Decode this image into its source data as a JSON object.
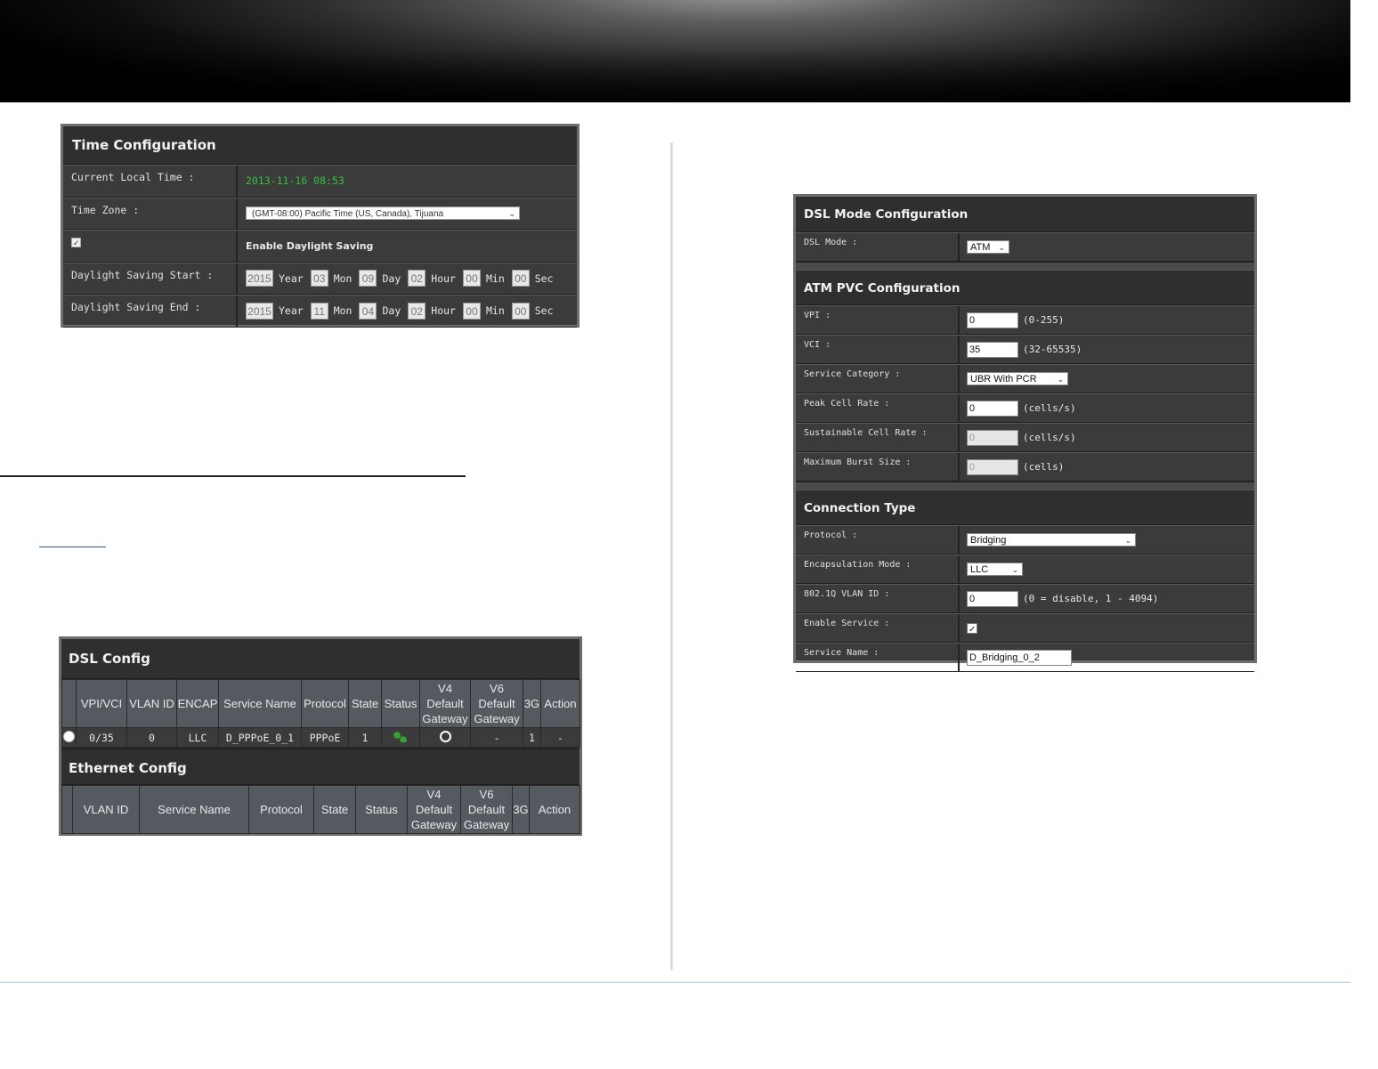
{
  "time_config": {
    "title": "Time Configuration",
    "current_local_time_label": "Current Local Time :",
    "current_local_time": "2013-11-16 08:53",
    "time_zone_label": "Time Zone :",
    "time_zone_value": "(GMT-08:00) Pacific Time (US, Canada), Tijuana",
    "daylight_saving_label": "Enable Daylight Saving",
    "daylight_saving_checked": true,
    "start_label": "Daylight Saving Start :",
    "end_label": "Daylight Saving End :",
    "units": {
      "year": "Year",
      "mon": "Mon",
      "day": "Day",
      "hour": "Hour",
      "min": "Min",
      "sec": "Sec"
    },
    "start": {
      "year": "2015",
      "mon": "03",
      "day": "09",
      "hour": "02",
      "min": "00",
      "sec": "00"
    },
    "end": {
      "year": "2015",
      "mon": "11",
      "day": "04",
      "hour": "02",
      "min": "00",
      "sec": "00"
    }
  },
  "dsl_config": {
    "title": "DSL Config",
    "columns": [
      "VPI/VCI",
      "VLAN ID",
      "ENCAP",
      "Service Name",
      "Protocol",
      "State",
      "Status",
      "V4 Default Gateway",
      "V6 Default Gateway",
      "3G",
      "Action"
    ],
    "row": {
      "vpi_vci": "0/35",
      "vlan_id": "0",
      "encap": "LLC",
      "service_name": "D_PPPoE_0_1",
      "protocol": "PPPoE",
      "state": "1",
      "v6_gateway": "-",
      "g3": "1",
      "action": "-"
    }
  },
  "ethernet_config": {
    "title": "Ethernet Config",
    "columns": [
      "VLAN ID",
      "Service Name",
      "Protocol",
      "State",
      "Status",
      "V4 Default Gateway",
      "V6 Default Gateway",
      "3G",
      "Action"
    ]
  },
  "dsl_mode": {
    "title": "DSL Mode Configuration",
    "mode_label": "DSL Mode :",
    "mode_value": "ATM"
  },
  "atm_pvc": {
    "title": "ATM PVC Configuration",
    "vpi_label": "VPI :",
    "vpi_value": "0",
    "vpi_hint": "(0-255)",
    "vci_label": "VCI :",
    "vci_value": "35",
    "vci_hint": "(32-65535)",
    "service_category_label": "Service Category :",
    "service_category_value": "UBR With PCR",
    "pcr_label": "Peak Cell Rate :",
    "pcr_value": "0",
    "pcr_hint": "(cells/s)",
    "scr_label": "Sustainable Cell Rate :",
    "scr_value": "0",
    "scr_hint": "(cells/s)",
    "mbs_label": "Maximum Burst Size :",
    "mbs_value": "0",
    "mbs_hint": "(cells)"
  },
  "connection_type": {
    "title": "Connection Type",
    "protocol_label": "Protocol :",
    "protocol_value": "Bridging",
    "encap_label": "Encapsulation Mode :",
    "encap_value": "LLC",
    "vlan_label": "802.1Q VLAN ID :",
    "vlan_value": "0",
    "vlan_hint": "(0 = disable, 1 - 4094)",
    "enable_label": "Enable Service :",
    "enable_checked": true,
    "service_name_label": "Service Name :",
    "service_name_value": "D_Bridging_0_2"
  }
}
